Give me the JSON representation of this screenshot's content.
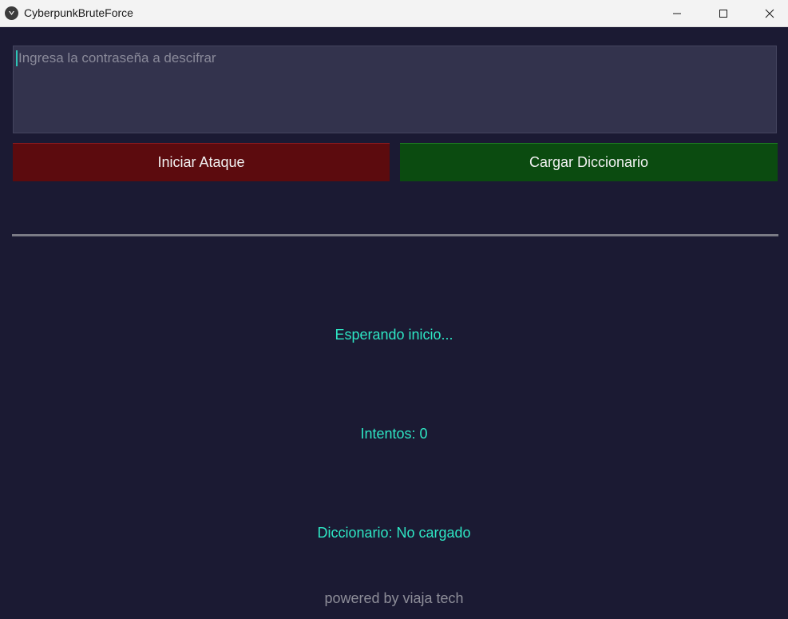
{
  "window": {
    "title": "CyberpunkBruteForce",
    "icons": {
      "app": "kivy-app-icon",
      "minimize": "minimize-icon",
      "maximize": "maximize-icon",
      "close": "close-icon"
    }
  },
  "password_input": {
    "value": "",
    "placeholder": "Ingresa la contraseña a descifrar"
  },
  "buttons": {
    "attack_label": "Iniciar Ataque",
    "load_dict_label": "Cargar Diccionario"
  },
  "progress": {
    "value": 0
  },
  "status": {
    "message": "Esperando inicio...",
    "attempts": "Intentos: 0",
    "dictionary": "Diccionario: No cargado"
  },
  "footer": {
    "text": "powered by viaja tech"
  },
  "colors": {
    "background": "#1b1a33",
    "input_bg": "#33334d",
    "attack_button": "#5c0b0e",
    "dict_button": "#0b4b10",
    "status_text": "#2ee6c4",
    "footer_text": "#8d8d98"
  }
}
